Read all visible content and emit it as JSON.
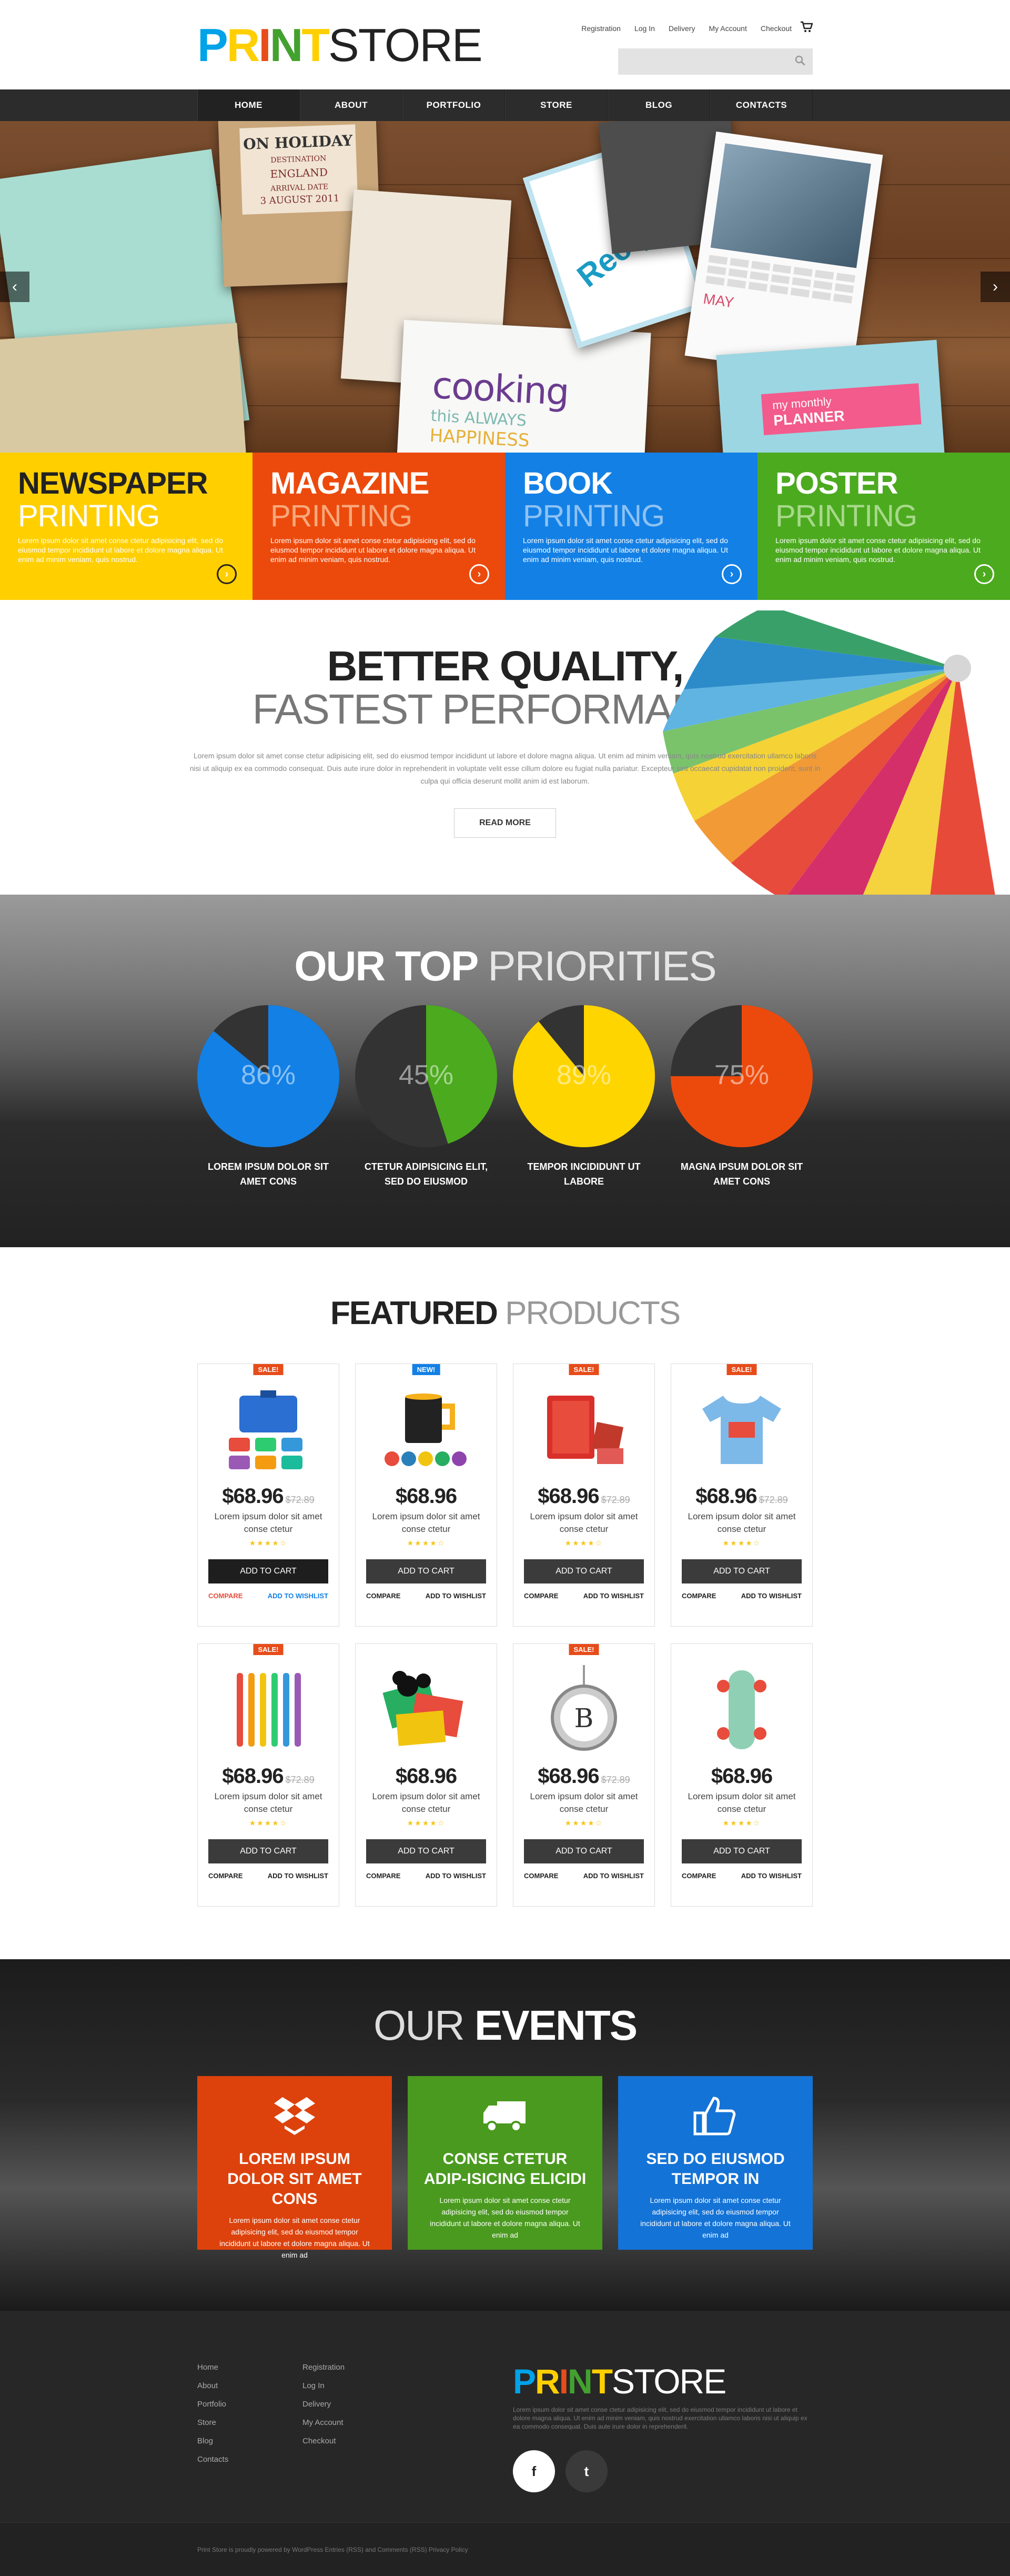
{
  "header": {
    "logo_letters": [
      "P",
      "R",
      "I",
      "N",
      "T"
    ],
    "logo_colors": [
      "#00a2e8",
      "#ffcf00",
      "#e74c1a",
      "#43a12f",
      "#ffcf00"
    ],
    "logo_rest": "STORE",
    "links": [
      "Registration",
      "Log In",
      "Delivery",
      "My Account",
      "Checkout"
    ],
    "cart_icon": "cart-icon",
    "search_icon": "search-icon"
  },
  "nav": [
    "HOME",
    "ABOUT",
    "PORTFOLIO",
    "STORE",
    "BLOG",
    "CONTACTS"
  ],
  "slider": {
    "prev": "‹",
    "next": "›",
    "card_text": [
      "ON HOLIDAY",
      "DESTINATION",
      "ENGLAND",
      "ARRIVAL DATE",
      "3 AUGUST 2011",
      "cooking",
      "this ALWAYS",
      "HAPPINESS",
      "Recipes",
      "MAY",
      "my monthly",
      "PLANNER"
    ]
  },
  "services": [
    {
      "title": "NEWSPAPER",
      "subtitle": "PRINTING",
      "color": "#ffcf00",
      "text": "Lorem ipsum dolor sit amet conse ctetur adipisicing elit, sed do eiusmod tempor incididunt ut labore et dolore magna aliqua. Ut enim ad minim veniam, quis nostrud."
    },
    {
      "title": "MAGAZINE",
      "subtitle": "PRINTING",
      "color": "#ec4a0c",
      "text": "Lorem ipsum dolor sit amet conse ctetur adipisicing elit, sed do eiusmod tempor incididunt ut labore et dolore magna aliqua. Ut enim ad minim veniam, quis nostrud."
    },
    {
      "title": "BOOK",
      "subtitle": "PRINTING",
      "color": "#1380e5",
      "text": "Lorem ipsum dolor sit amet conse ctetur adipisicing elit, sed do eiusmod tempor incididunt ut labore et dolore magna aliqua. Ut enim ad minim veniam, quis nostrud."
    },
    {
      "title": "POSTER",
      "subtitle": "PRINTING",
      "color": "#4caa1f",
      "text": "Lorem ipsum dolor sit amet conse ctetur adipisicing elit, sed do eiusmod tempor incididunt ut labore et dolore magna aliqua. Ut enim ad minim veniam, quis nostrud."
    }
  ],
  "quality": {
    "title": "BETTER QUALITY,",
    "subtitle": "FASTEST PERFORMANCE",
    "text": "Lorem ipsum dolor sit amet conse ctetur adipisicing elit, sed do eiusmod tempor incididunt ut labore et dolore magna aliqua. Ut enim ad minim veniam, quis nostrud exercitation ullamco laboris nisi ut aliquip ex ea commodo consequat. Duis aute irure dolor in reprehenderit in voluptate velit esse cillum dolore eu fugiat nulla pariatur. Excepteur sint occaecat cupidatat non proident, sunt in culpa qui officia deserunt mollit anim id est laborum.",
    "button": "READ MORE"
  },
  "priorities": {
    "title_bold": "OUR TOP",
    "title_light": "PRIORITIES",
    "items": [
      {
        "percent": "86%",
        "value": 0.86,
        "color": "#1380e5",
        "caption": "LOREM IPSUM DOLOR SIT AMET CONS"
      },
      {
        "percent": "45%",
        "value": 0.45,
        "color": "#4caa1f",
        "caption": "CTETUR ADIPISICING ELIT, SED DO EIUSMOD"
      },
      {
        "percent": "89%",
        "value": 0.89,
        "color": "#ffd500",
        "caption": "TEMPOR INCIDIDUNT UT LABORE"
      },
      {
        "percent": "75%",
        "value": 0.75,
        "color": "#ec4a0c",
        "caption": "MAGNA IPSUM DOLOR SIT AMET CONS"
      }
    ]
  },
  "featured": {
    "title_bold": "FEATURED",
    "title_light": "PRODUCTS",
    "badge_colors": {
      "SALE!": "#e74c1a",
      "NEW!": "#1380e5"
    },
    "products": [
      {
        "badge": "SALE!",
        "icon": "bag-icon",
        "price": "$68.96",
        "old_price": "$72.89",
        "name": "Lorem ipsum dolor sit amet conse ctetur",
        "stars": "★★★★☆",
        "cart": "ADD TO CART",
        "compare": "COMPARE",
        "wishlist": "ADD TO WISHLIST"
      },
      {
        "badge": "NEW!",
        "icon": "mug-icon",
        "price": "$68.96",
        "old_price": "",
        "name": "Lorem ipsum dolor sit amet conse ctetur",
        "stars": "★★★★☆",
        "cart": "ADD TO CART",
        "compare": "COMPARE",
        "wishlist": "ADD TO WISHLIST"
      },
      {
        "badge": "SALE!",
        "icon": "tablet-case-icon",
        "price": "$68.96",
        "old_price": "$72.89",
        "name": "Lorem ipsum dolor sit amet conse ctetur",
        "stars": "★★★★☆",
        "cart": "ADD TO CART",
        "compare": "COMPARE",
        "wishlist": "ADD TO WISHLIST"
      },
      {
        "badge": "SALE!",
        "icon": "tshirt-icon",
        "price": "$68.96",
        "old_price": "$72.89",
        "name": "Lorem ipsum dolor sit amet conse ctetur",
        "stars": "★★★★☆",
        "cart": "ADD TO CART",
        "compare": "COMPARE",
        "wishlist": "ADD TO WISHLIST"
      },
      {
        "badge": "SALE!",
        "icon": "pens-icon",
        "price": "$68.96",
        "old_price": "$72.89",
        "name": "Lorem ipsum dolor sit amet conse ctetur",
        "stars": "★★★★☆",
        "cart": "ADD TO CART",
        "compare": "COMPARE",
        "wishlist": "ADD TO WISHLIST"
      },
      {
        "badge": "",
        "icon": "cards-icon",
        "price": "$68.96",
        "old_price": "",
        "name": "Lorem ipsum dolor sit amet conse ctetur",
        "stars": "★★★★☆",
        "cart": "ADD TO CART",
        "compare": "COMPARE",
        "wishlist": "ADD TO WISHLIST"
      },
      {
        "badge": "SALE!",
        "icon": "pendant-icon",
        "price": "$68.96",
        "old_price": "$72.89",
        "name": "Lorem ipsum dolor sit amet conse ctetur",
        "stars": "★★★★☆",
        "cart": "ADD TO CART",
        "compare": "COMPARE",
        "wishlist": "ADD TO WISHLIST"
      },
      {
        "badge": "",
        "icon": "skateboard-icon",
        "price": "$68.96",
        "old_price": "",
        "name": "Lorem ipsum dolor sit amet conse ctetur",
        "stars": "★★★★☆",
        "cart": "ADD TO CART",
        "compare": "COMPARE",
        "wishlist": "ADD TO WISHLIST"
      }
    ]
  },
  "events": {
    "title_light": "OUR",
    "title_bold": "EVENTS",
    "items": [
      {
        "icon": "dropbox-icon",
        "color": "#dd420c",
        "title": "LOREM IPSUM DOLOR SIT AMET CONS",
        "text": "Lorem ipsum dolor sit amet conse ctetur adipisicing elit, sed do eiusmod tempor incididunt ut labore et dolore magna aliqua. Ut enim ad"
      },
      {
        "icon": "truck-icon",
        "color": "#4a9a1f",
        "title": "CONSE CTETUR ADIP-ISICING ELICIDI",
        "text": "Lorem ipsum dolor sit amet conse ctetur adipisicing elit, sed do eiusmod tempor incididunt ut labore et dolore magna aliqua. Ut enim ad"
      },
      {
        "icon": "thumbs-up-icon",
        "color": "#1473d6",
        "title": "SED DO EIUSMOD TEMPOR IN",
        "text": "Lorem ipsum dolor sit amet conse ctetur adipisicing elit, sed do eiusmod tempor incididunt ut labore et dolore magna aliqua. Ut enim ad"
      }
    ]
  },
  "footer": {
    "col1": [
      "Home",
      "About",
      "Portfolio",
      "Store",
      "Blog",
      "Contacts"
    ],
    "col2": [
      "Registration",
      "Log In",
      "Delivery",
      "My Account",
      "Checkout"
    ],
    "logo_rest": "STORE",
    "desc": "Lorem ipsum dolor sit amet conse ctetur adipisicing elit, sed do eiusmod tempor incididunt ut labore et dolore magna aliqua. Ut enim ad minim veniam, quis nostrud exercitation ullamco laboris nisi ut aliquip ex ea commodo consequat. Duis aute irure dolor in reprehenderit.",
    "facebook": "f",
    "twitter": "t",
    "copyright": "Print Store is proudly powered by WordPress Entries (RSS) and Comments (RSS) Privacy Policy"
  }
}
